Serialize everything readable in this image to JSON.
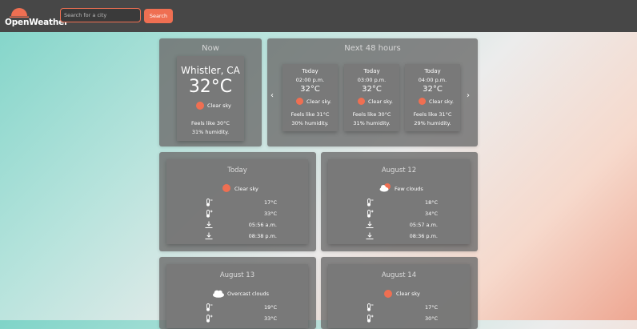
{
  "brand": {
    "name": "OpenWeather",
    "accent": "#ef6f52"
  },
  "search": {
    "placeholder": "Search for a city",
    "button_label": "Search"
  },
  "now": {
    "title": "Now",
    "city": "Whistler, CA",
    "temp": "32°C",
    "condition": "Clear sky",
    "feels_like": "Feels like 30°C",
    "humidity": "31% humidity."
  },
  "hourly": {
    "title": "Next 48 hours",
    "items": [
      {
        "day": "Today",
        "time": "02:00 p.m.",
        "temp": "32°C",
        "condition": "Clear sky.",
        "feels_like": "Feels like 31°C",
        "humidity": "30% humidity."
      },
      {
        "day": "Today",
        "time": "03:00 p.m.",
        "temp": "32°C",
        "condition": "Clear sky.",
        "feels_like": "Feels like 30°C",
        "humidity": "31% humidity."
      },
      {
        "day": "Today",
        "time": "04:00 p.m.",
        "temp": "32°C",
        "condition": "Clear sky.",
        "feels_like": "Feels like 31°C",
        "humidity": "29% humidity."
      }
    ]
  },
  "daily": [
    {
      "title": "Today",
      "condition": "Clear sky",
      "icon": "sun-icon",
      "min": "17°C",
      "max": "33°C",
      "sunrise": "05:56 a.m.",
      "sunset": "08:38 p.m."
    },
    {
      "title": "August 12",
      "condition": "Few clouds",
      "icon": "partly-cloudy-icon",
      "min": "18°C",
      "max": "34°C",
      "sunrise": "05:57 a.m.",
      "sunset": "08:36 p.m."
    },
    {
      "title": "August 13",
      "condition": "Overcast clouds",
      "icon": "cloud-icon",
      "min": "19°C",
      "max": "33°C"
    },
    {
      "title": "August 14",
      "condition": "Clear sky",
      "icon": "sun-icon",
      "min": "17°C",
      "max": "30°C"
    }
  ]
}
